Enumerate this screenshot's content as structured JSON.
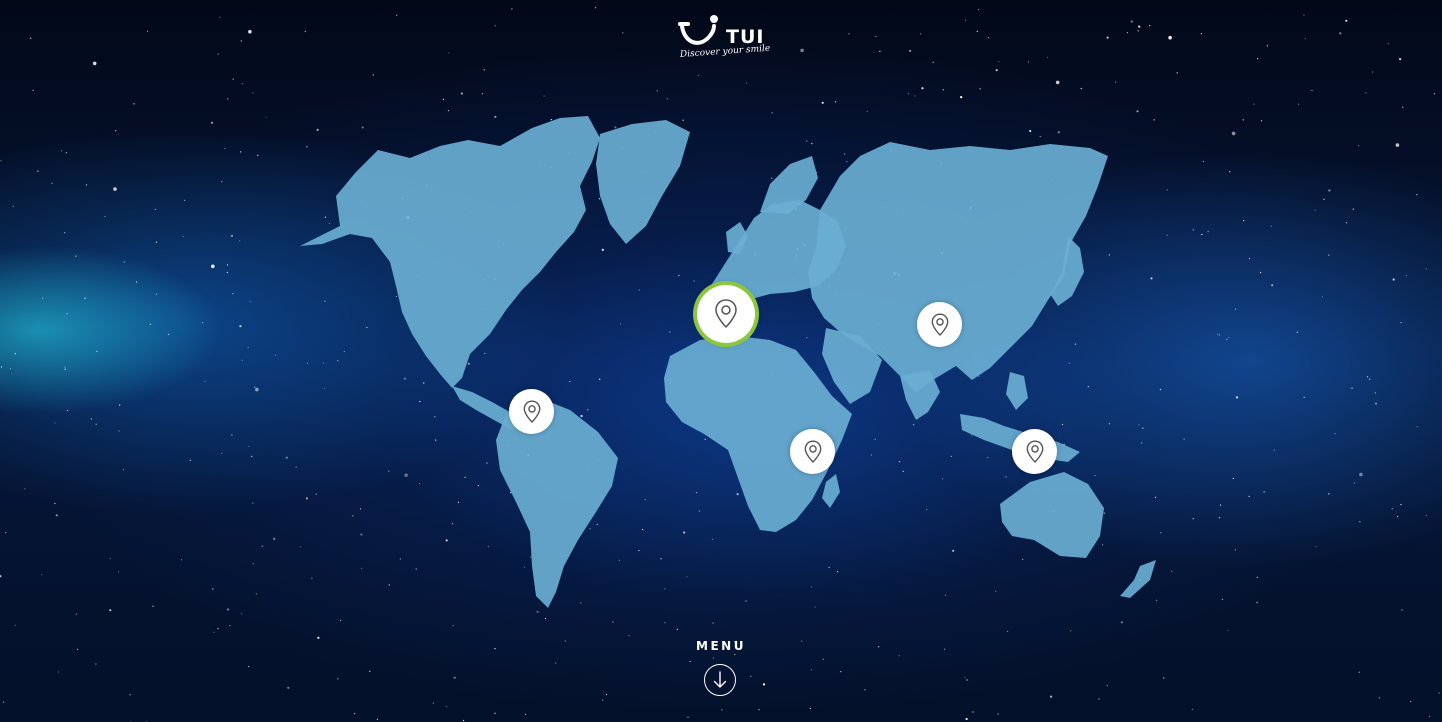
{
  "logo": {
    "brand": "TUI",
    "tagline": "Discover your smile",
    "icon": "tui-smile-icon"
  },
  "colors": {
    "land": "#6aaed2",
    "pin_fill": "#ffffff",
    "pin_icon": "#555555",
    "active_ring": "#8cc63f",
    "text": "#ffffff"
  },
  "map": {
    "pins": [
      {
        "region": "europe",
        "icon": "map-pin-icon",
        "active": true
      },
      {
        "region": "asia",
        "icon": "map-pin-icon",
        "active": false
      },
      {
        "region": "central-america",
        "icon": "map-pin-icon",
        "active": false
      },
      {
        "region": "africa",
        "icon": "map-pin-icon",
        "active": false
      },
      {
        "region": "southeast-asia",
        "icon": "map-pin-icon",
        "active": false
      }
    ]
  },
  "menu": {
    "label": "MENU",
    "icon": "arrow-down-circle-icon"
  }
}
